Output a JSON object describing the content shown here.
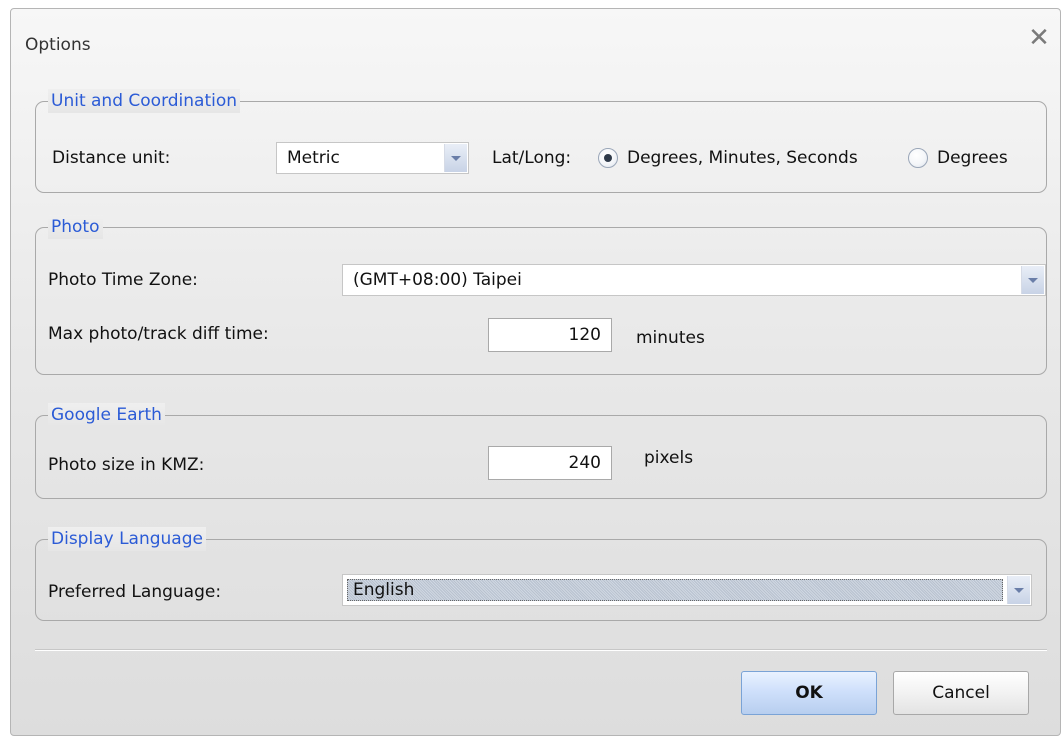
{
  "window": {
    "title": "Options",
    "close_glyph": "✕"
  },
  "unit_group": {
    "title": "Unit and Coordination",
    "distance_label": "Distance unit:",
    "distance_value": "Metric",
    "latlong_label": "Lat/Long:",
    "option_dms": "Degrees, Minutes, Seconds",
    "option_deg": "Degrees",
    "selected": "Degrees, Minutes, Seconds"
  },
  "photo_group": {
    "title": "Photo",
    "timezone_label": "Photo Time Zone:",
    "timezone_value": "(GMT+08:00) Taipei",
    "maxdiff_label": "Max photo/track diff time:",
    "maxdiff_value": "120",
    "maxdiff_unit": "minutes"
  },
  "ge_group": {
    "title": "Google Earth",
    "size_label": "Photo size in KMZ:",
    "size_value": "240",
    "size_unit": "pixels"
  },
  "lang_group": {
    "title": "Display Language",
    "pref_label": "Preferred Language:",
    "pref_value": "English"
  },
  "buttons": {
    "ok": "OK",
    "cancel": "Cancel"
  },
  "icons": {
    "close": "close-icon",
    "dropdown": "chevron-down-icon"
  }
}
